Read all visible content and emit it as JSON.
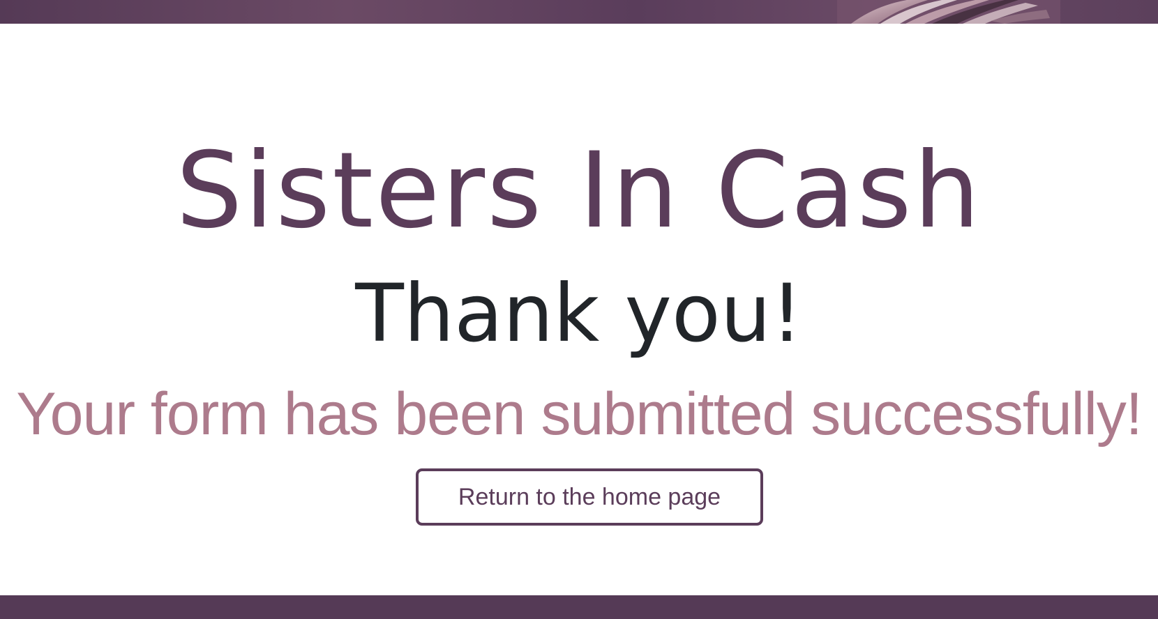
{
  "header": {
    "banner_image": "purple-banner-photo"
  },
  "main": {
    "brand_title": "Sisters In Cash",
    "thank_heading": "Thank you!",
    "success_message": "Your form has been submitted successfully!",
    "home_button_label": "Return to the home page"
  },
  "colors": {
    "brand": "#5b3d5a",
    "heading": "#212529",
    "message": "#ad7b8c",
    "banner": "#553a56",
    "background": "#ffffff"
  }
}
